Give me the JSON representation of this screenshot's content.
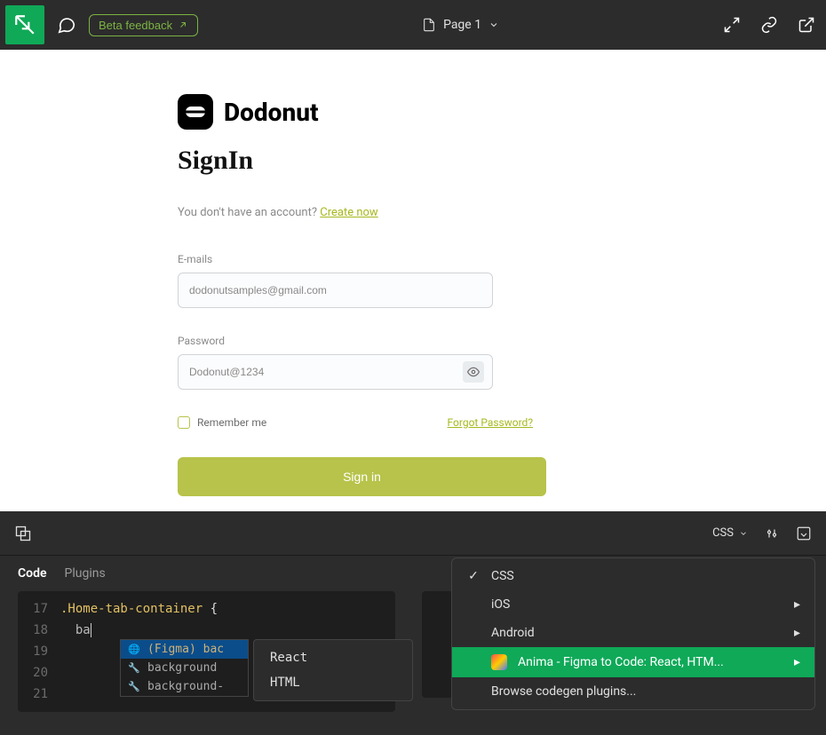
{
  "topbar": {
    "beta_label": "Beta feedback",
    "page_title": "Page 1"
  },
  "signin": {
    "brand": "Dodonut",
    "title": "SignIn",
    "subtext_prefix": "You don't have an account? ",
    "create_link": "Create now",
    "email_label": "E-mails",
    "email_value": "dodonutsamples@gmail.com",
    "password_label": "Password",
    "password_value": "Dodonut@1234",
    "remember_label": "Remember me",
    "forgot_label": "Forgot Password?",
    "submit_label": "Sign in"
  },
  "panel": {
    "tabs": {
      "code": "Code",
      "plugins": "Plugins"
    },
    "css_dropdown_label": "CSS"
  },
  "code": {
    "lines": [
      "17",
      "18",
      "19",
      "20",
      "21"
    ],
    "selector": ".Home-tab-container",
    "brace_open": "{",
    "typed": "ba",
    "autocomplete": {
      "row1": "(Figma) bac",
      "row2": "background",
      "row3": "background-"
    },
    "context_menu": {
      "react": "React",
      "html": "HTML"
    }
  },
  "dropdown": {
    "css": "CSS",
    "ios": "iOS",
    "android": "Android",
    "anima": "Anima - Figma to Code: React, HTM...",
    "browse": "Browse codegen plugins..."
  }
}
